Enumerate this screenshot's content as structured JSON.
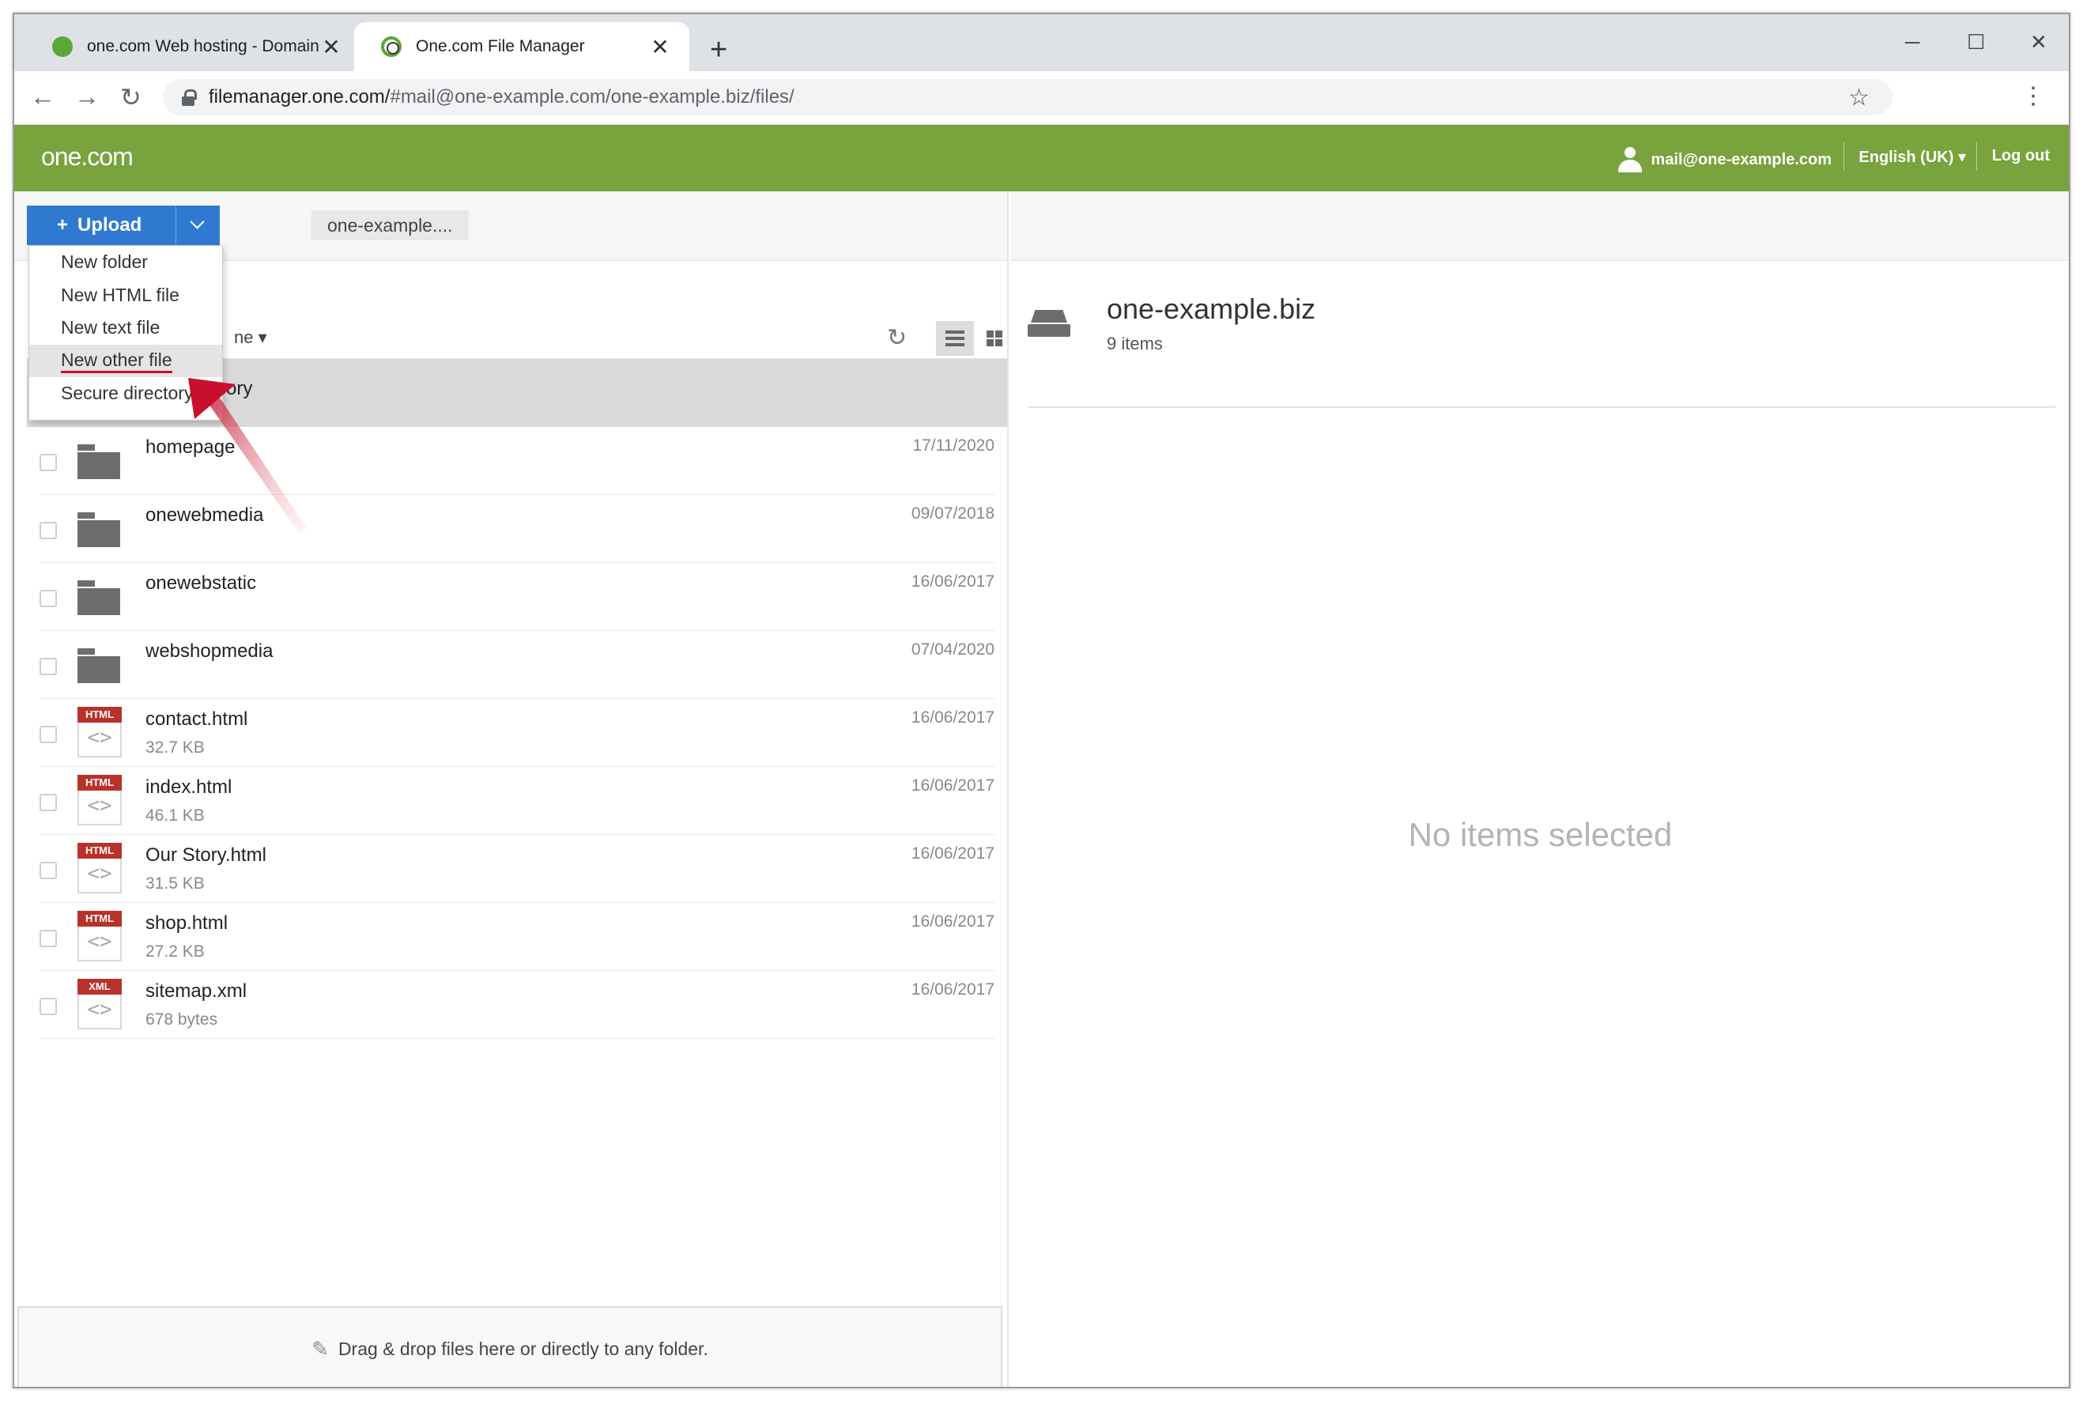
{
  "browser": {
    "tabs": [
      {
        "title": "one.com Web hosting  -  Domain",
        "close": "✕"
      },
      {
        "title": "One.com File Manager",
        "close": "✕"
      }
    ],
    "new_tab": "+",
    "url_host": "filemanager.one.com/",
    "url_path": "#mail@one-example.com/one-example.biz/files/"
  },
  "app": {
    "logo": "one.com",
    "user": "mail@one-example.com",
    "language": "English (UK)",
    "logout": "Log out",
    "brand_color": "#78a33d",
    "accent_color": "#2f7ad0"
  },
  "toolbar": {
    "upload_label": "Upload",
    "breadcrumb": "one-example...."
  },
  "menu": {
    "items": [
      "New folder",
      "New HTML file",
      "New text file",
      "New other file",
      "Secure directory"
    ],
    "highlighted": "New other file"
  },
  "list": {
    "sort_label": "ne",
    "first_row_partial": "ory",
    "rows": [
      {
        "name": "homepage",
        "type": "folder",
        "date": "17/11/2020",
        "size": ""
      },
      {
        "name": "onewebmedia",
        "type": "folder",
        "date": "09/07/2018",
        "size": ""
      },
      {
        "name": "onewebstatic",
        "type": "folder",
        "date": "16/06/2017",
        "size": ""
      },
      {
        "name": "webshopmedia",
        "type": "folder",
        "date": "07/04/2020",
        "size": ""
      },
      {
        "name": "contact.html",
        "type": "HTML",
        "date": "16/06/2017",
        "size": "32.7 KB"
      },
      {
        "name": "index.html",
        "type": "HTML",
        "date": "16/06/2017",
        "size": "46.1 KB"
      },
      {
        "name": "Our Story.html",
        "type": "HTML",
        "date": "16/06/2017",
        "size": "31.5 KB"
      },
      {
        "name": "shop.html",
        "type": "HTML",
        "date": "16/06/2017",
        "size": "27.2 KB"
      },
      {
        "name": "sitemap.xml",
        "type": "XML",
        "date": "16/06/2017",
        "size": "678 bytes"
      }
    ],
    "dropzone": "Drag & drop files here or directly to any folder."
  },
  "details": {
    "title": "one-example.biz",
    "count": "9 items",
    "empty": "No items selected"
  }
}
